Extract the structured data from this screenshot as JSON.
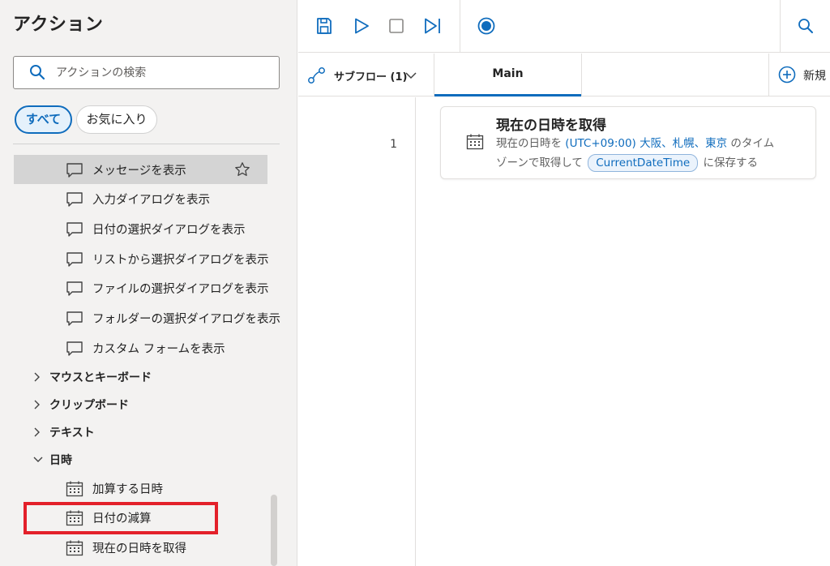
{
  "actions_panel": {
    "title": "アクション",
    "search": {
      "placeholder": "アクションの検索",
      "value": ""
    },
    "filters": {
      "all": "すべて",
      "favorites": "お気に入り"
    },
    "ui_items": [
      {
        "label": "メッセージを表示",
        "icon": "message-icon",
        "selected": true
      },
      {
        "label": "入力ダイアログを表示",
        "icon": "message-icon"
      },
      {
        "label": "日付の選択ダイアログを表示",
        "icon": "message-icon"
      },
      {
        "label": "リストから選択ダイアログを表示",
        "icon": "message-icon"
      },
      {
        "label": "ファイルの選択ダイアログを表示",
        "icon": "message-icon"
      },
      {
        "label": "フォルダーの選択ダイアログを表示",
        "icon": "message-icon"
      },
      {
        "label": "カスタム フォームを表示",
        "icon": "message-icon"
      }
    ],
    "groups": [
      {
        "label": "マウスとキーボード",
        "expanded": false
      },
      {
        "label": "クリップボード",
        "expanded": false
      },
      {
        "label": "テキスト",
        "expanded": false
      },
      {
        "label": "日時",
        "expanded": true
      }
    ],
    "datetime_items": [
      {
        "label": "加算する日時",
        "icon": "calendar-icon"
      },
      {
        "label": "日付の減算",
        "icon": "calendar-icon",
        "highlighted": true
      },
      {
        "label": "現在の日時を取得",
        "icon": "calendar-icon"
      }
    ]
  },
  "toolbar": {
    "icons": [
      "save-icon",
      "run-icon",
      "stop-icon",
      "run-next-action-icon",
      "record-icon",
      "search-icon"
    ]
  },
  "tabs": {
    "subflows_label": "サブフロー (1)",
    "main_label": "Main",
    "new_label": "新規"
  },
  "flow": {
    "steps": [
      {
        "line": "1",
        "title": "現在の日時を取得",
        "desc_prefix": "現在の日時を",
        "timezone": "(UTC+09:00) 大阪、札幌、東京",
        "desc_mid": "のタイム",
        "desc_line2_prefix": "ゾーンで取得して",
        "variable": "CurrentDateTime",
        "desc_suffix": "に保存する"
      }
    ]
  },
  "colors": {
    "accent": "#0f6cbd",
    "highlight_box": "#e3202a",
    "panel_bg": "#f3f2f1",
    "selected_row": "#d4d4d4"
  }
}
